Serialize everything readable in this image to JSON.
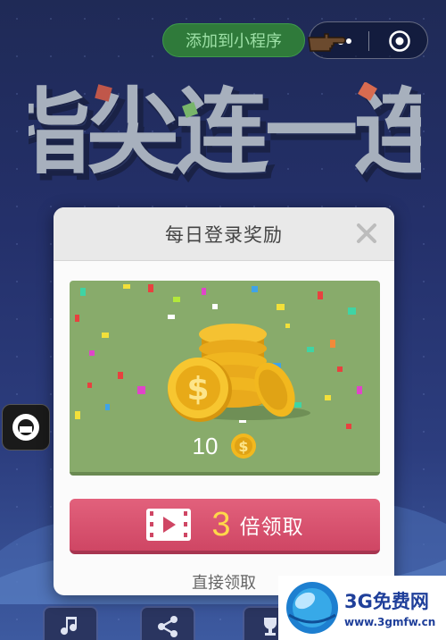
{
  "topbar": {
    "add_mini_program": "添加到小程序",
    "more_icon": "more-dots-icon",
    "target_icon": "target-icon"
  },
  "game": {
    "title": "指尖连一连"
  },
  "side": {
    "chat_icon": "chat-bubble-icon"
  },
  "bottom": {
    "items": [
      {
        "icon": "music-note-icon"
      },
      {
        "icon": "share-icon"
      },
      {
        "icon": "trophy-icon"
      }
    ]
  },
  "modal": {
    "title": "每日登录奖励",
    "reward_amount": "10",
    "multiplier": "3",
    "multiplier_label": "倍领取",
    "direct_claim": "直接领取"
  },
  "watermark": {
    "name": "3G免费网",
    "url": "www.3gmfw.cn"
  },
  "colors": {
    "card_green": "#88ab6b",
    "button_pink": "#d94f6d",
    "coin_gold": "#f2b81e",
    "multiplier_yellow": "#ffd84a"
  }
}
